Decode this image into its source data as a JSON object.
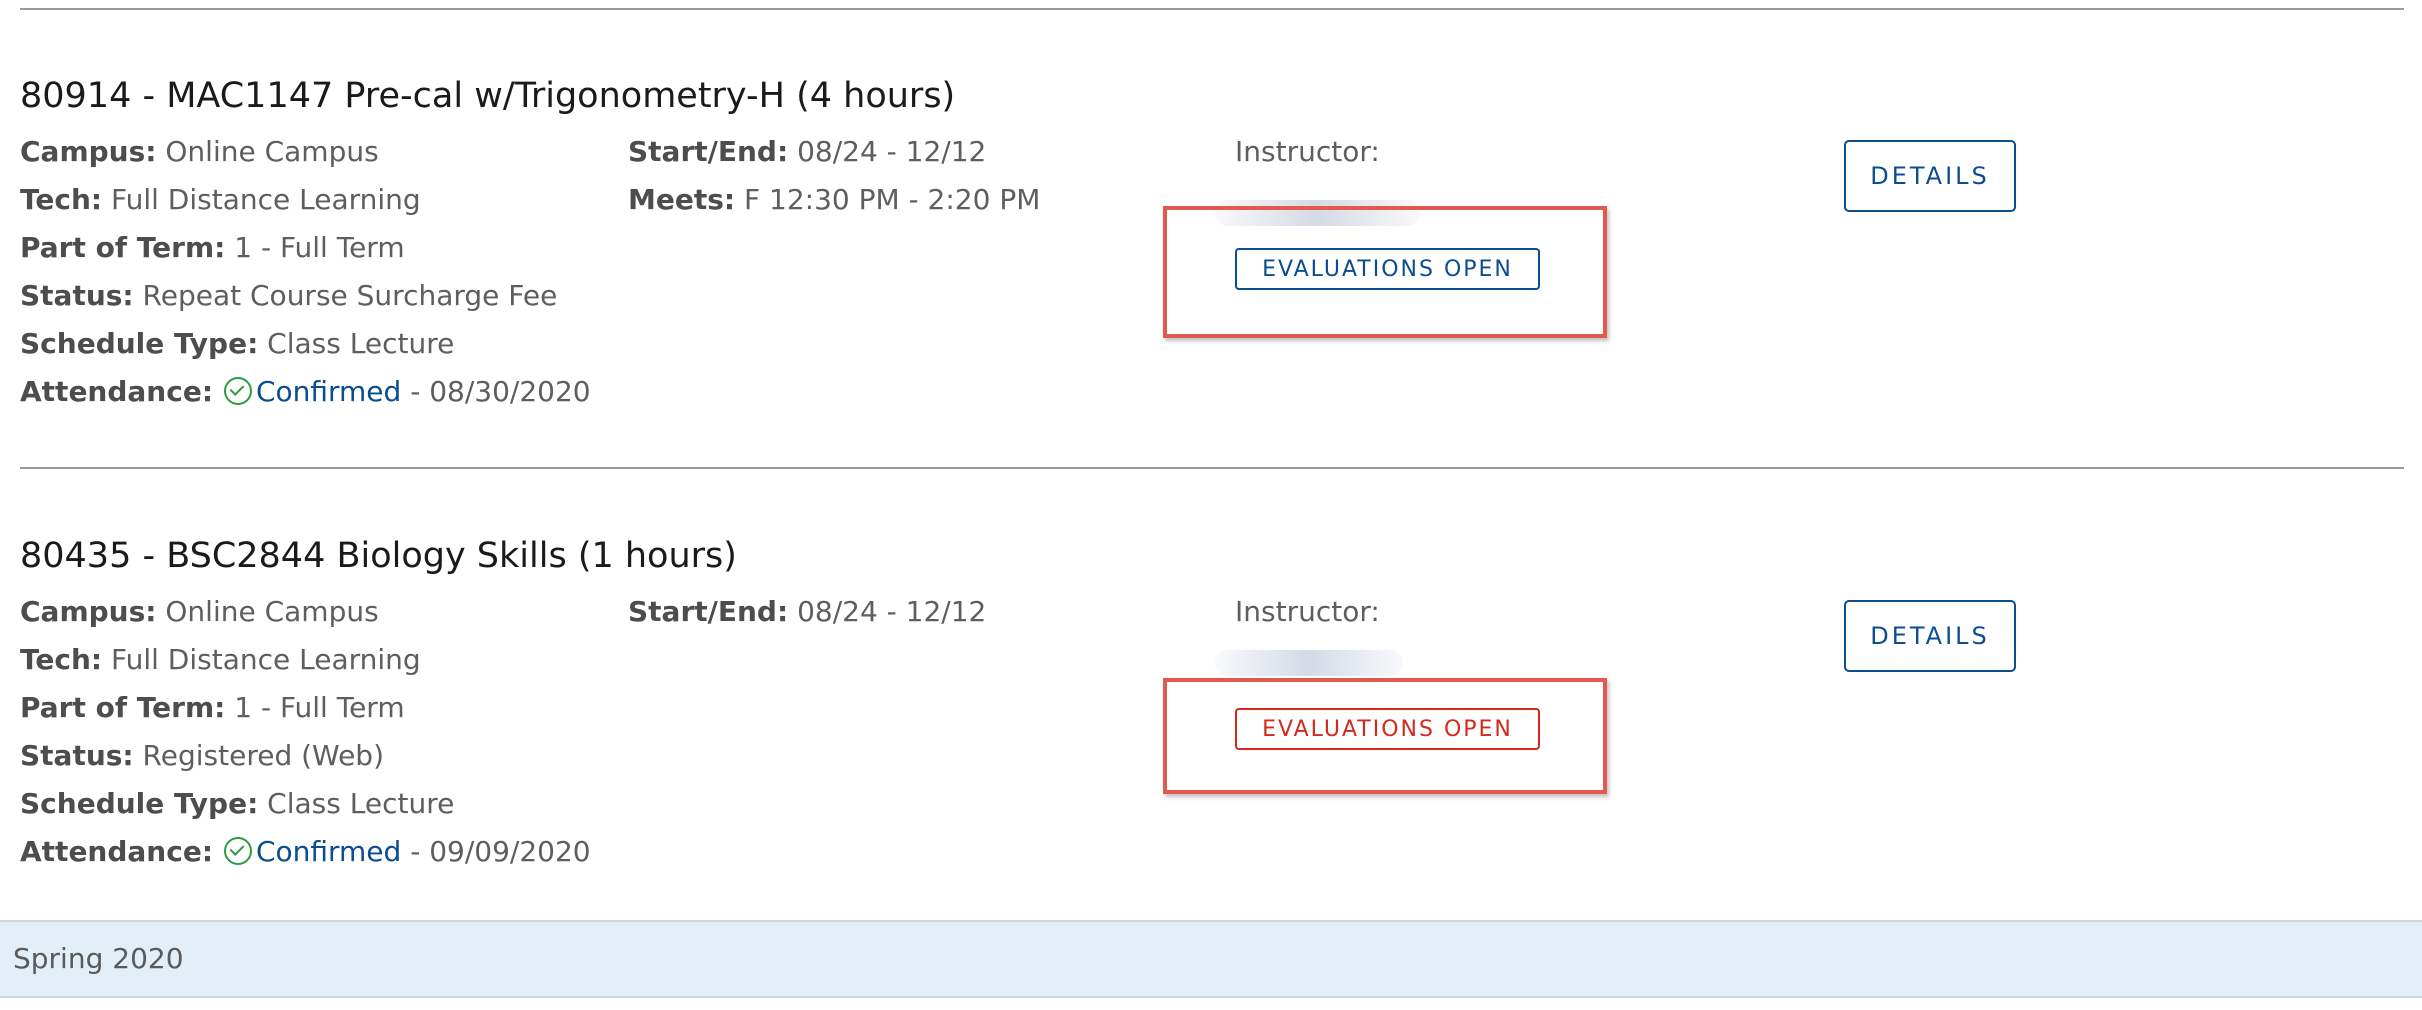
{
  "courses": [
    {
      "title": "80914 - MAC1147 Pre-cal w/Trigonometry-H (4 hours)",
      "campus_label": "Campus:",
      "campus": "Online Campus",
      "tech_label": "Tech:",
      "tech": "Full Distance Learning",
      "part_label": "Part of Term:",
      "part": "1 - Full Term",
      "status_label": "Status:",
      "status": "Repeat Course Surcharge Fee",
      "schedule_label": "Schedule Type:",
      "schedule": "Class Lecture",
      "attendance_label": "Attendance:",
      "attendance_status": "Confirmed",
      "attendance_date": "- 08/30/2020",
      "startend_label": "Start/End:",
      "startend": "08/24 - 12/12",
      "meets_label": "Meets:",
      "meets": "F 12:30 PM - 2:20 PM",
      "instructor_label": "Instructor:",
      "eval_label": "EVALUATIONS OPEN",
      "details_label": "DETAILS"
    },
    {
      "title": "80435 - BSC2844 Biology Skills (1 hours)",
      "campus_label": "Campus:",
      "campus": "Online Campus",
      "tech_label": "Tech:",
      "tech": "Full Distance Learning",
      "part_label": "Part of Term:",
      "part": "1 - Full Term",
      "status_label": "Status:",
      "status": "Registered (Web)",
      "schedule_label": "Schedule Type:",
      "schedule": "Class Lecture",
      "attendance_label": "Attendance:",
      "attendance_status": "Confirmed",
      "attendance_date": "- 09/09/2020",
      "startend_label": "Start/End:",
      "startend": "08/24 - 12/12",
      "instructor_label": "Instructor:",
      "eval_label": "EVALUATIONS OPEN",
      "details_label": "DETAILS"
    }
  ],
  "term": {
    "label": "Spring 2020"
  },
  "colors": {
    "link_blue": "#0b4d91",
    "eval_red": "#d12a1f",
    "highlight_red": "#e2594d",
    "check_green": "#2e9b44",
    "term_bar": "#e3eff6"
  },
  "icons": {
    "attendance": "check-circle-icon"
  }
}
